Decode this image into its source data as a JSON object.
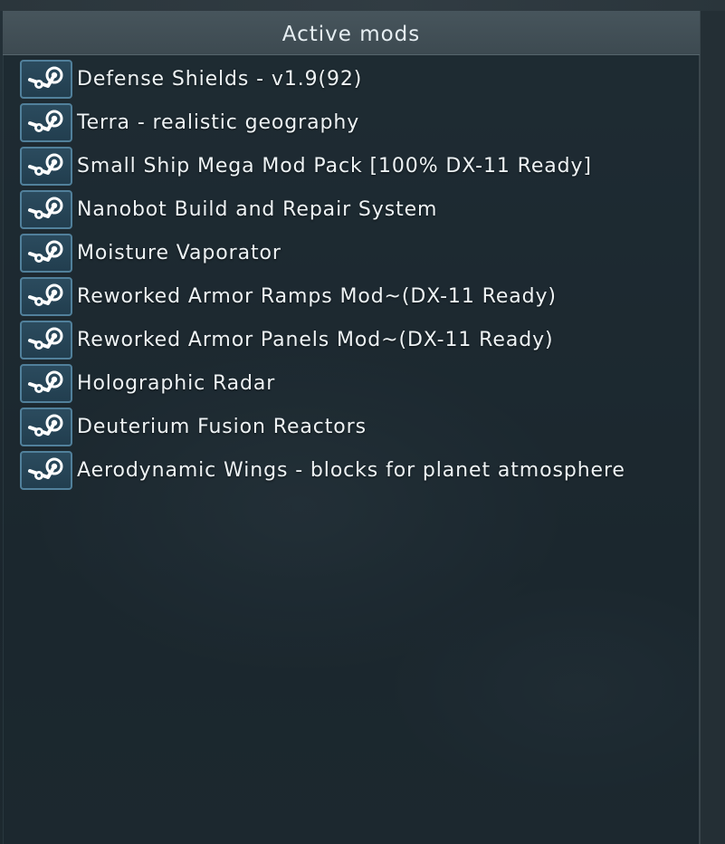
{
  "panel": {
    "title": "Active mods"
  },
  "mods": [
    {
      "name": "Defense Shields - v1.9(92)",
      "source_icon": "steam-icon"
    },
    {
      "name": "Terra - realistic geography",
      "source_icon": "steam-icon"
    },
    {
      "name": "Small Ship Mega Mod Pack [100% DX-11 Ready]",
      "source_icon": "steam-icon"
    },
    {
      "name": "Nanobot Build and Repair System",
      "source_icon": "steam-icon"
    },
    {
      "name": "Moisture Vaporator",
      "source_icon": "steam-icon"
    },
    {
      "name": "Reworked Armor Ramps Mod~(DX-11 Ready)",
      "source_icon": "steam-icon"
    },
    {
      "name": "Reworked Armor Panels Mod~(DX-11 Ready)",
      "source_icon": "steam-icon"
    },
    {
      "name": "Holographic Radar",
      "source_icon": "steam-icon"
    },
    {
      "name": "Deuterium Fusion Reactors",
      "source_icon": "steam-icon"
    },
    {
      "name": "Aerodynamic Wings - blocks for planet atmosphere",
      "source_icon": "steam-icon"
    }
  ],
  "colors": {
    "header_bg": "#3d4a51",
    "badge_border": "#51809b",
    "badge_bg": "#223e4f",
    "text": "#eef3f5"
  }
}
